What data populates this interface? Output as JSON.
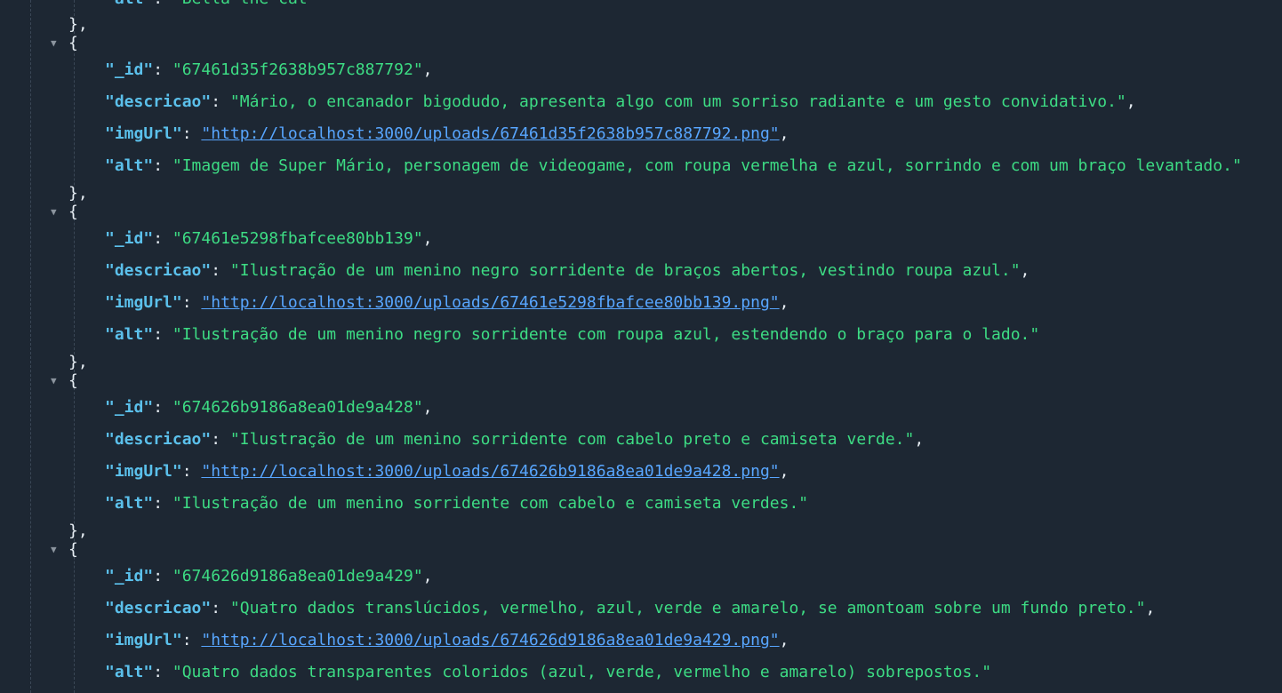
{
  "prev_alt": {
    "key": "alt",
    "value": "Bella the cat"
  },
  "toggle_glyph": "▼",
  "colors": {
    "background": "#1d2733",
    "key": "#5bc0eb",
    "string": "#3ddc84",
    "link": "#58a6ff",
    "punctuation": "#e6edf3"
  },
  "records": [
    {
      "_id": "67461d35f2638b957c887792",
      "descricao": "Mário, o encanador bigodudo, apresenta algo com um sorriso radiante e um gesto convidativo.",
      "imgUrl": "http://localhost:3000/uploads/67461d35f2638b957c887792.png",
      "alt": "Imagem de Super Mário, personagem de videogame, com roupa vermelha e azul, sorrindo e com um braço levantado."
    },
    {
      "_id": "67461e5298fbafcee80bb139",
      "descricao": "Ilustração de um menino negro sorridente de braços abertos, vestindo roupa azul.",
      "imgUrl": "http://localhost:3000/uploads/67461e5298fbafcee80bb139.png",
      "alt": "Ilustração de um menino negro sorridente com roupa azul, estendendo o braço para o lado."
    },
    {
      "_id": "674626b9186a8ea01de9a428",
      "descricao": "Ilustração de um menino sorridente com cabelo preto e camiseta verde.",
      "imgUrl": "http://localhost:3000/uploads/674626b9186a8ea01de9a428.png",
      "alt": "Ilustração de um menino sorridente com cabelo e camiseta verdes."
    },
    {
      "_id": "674626d9186a8ea01de9a429",
      "descricao": "Quatro dados translúcidos, vermelho, azul, verde e amarelo, se amontoam sobre um fundo preto.",
      "imgUrl": "http://localhost:3000/uploads/674626d9186a8ea01de9a429.png",
      "alt": "Quatro dados transparentes coloridos (azul, verde, vermelho e amarelo) sobrepostos."
    }
  ]
}
